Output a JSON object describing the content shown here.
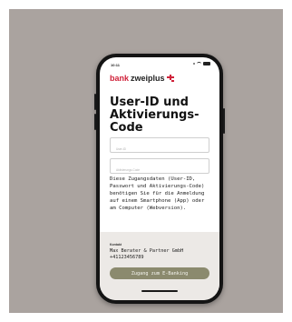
{
  "status_bar": {
    "time": "10:11"
  },
  "brand": {
    "part1": "bank",
    "part2": "zweiplus",
    "color": "#d0223a"
  },
  "page_title": "User-ID und Aktivierungs-Code",
  "fields": {
    "user_id": {
      "placeholder": "User-ID",
      "value": ""
    },
    "activation_code": {
      "placeholder": "Aktivierungs-Code",
      "value": ""
    }
  },
  "description": "Diese Zugangsdaten (User-ID, Passwort und Aktivierungs-Code) benötigen Sie für die Anmeldung auf einem Smartphone (App) oder am Computer (Webversion).",
  "contact": {
    "label": "Kontakt",
    "name": "Max Berater & Partner GmbH",
    "phone": "+41123456789"
  },
  "cta_label": "Zugang zum E-Banking",
  "colors": {
    "background": "#aaa39f",
    "cta": "#8b8a6e",
    "footer": "#ece9e6"
  }
}
